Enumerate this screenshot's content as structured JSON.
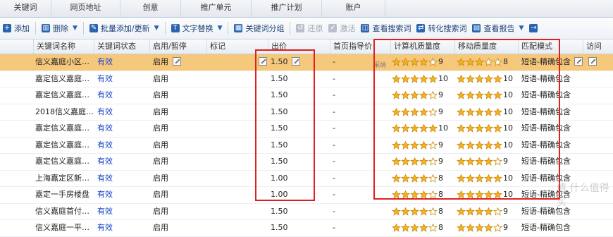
{
  "tabs": [
    {
      "label": "关键词",
      "active": true
    },
    {
      "label": "网页地址",
      "active": false
    },
    {
      "label": "创意",
      "active": false
    },
    {
      "label": "推广单元",
      "active": false
    },
    {
      "label": "推广计划",
      "active": false
    },
    {
      "label": "账户",
      "active": false
    }
  ],
  "toolbar": {
    "add": "添加",
    "delete": "删除",
    "batch": "批量添加/更新",
    "replace": "文字替换",
    "group": "关键词分组",
    "restore": "还原",
    "activate": "激活",
    "view_search": "查看搜索词",
    "convert_search": "转化搜索词",
    "view_report": "查看报告",
    "more_icon": "arrow-right-icon"
  },
  "columns": {
    "name": "关键词名称",
    "status": "关键词状态",
    "enable": "启用/暂停",
    "mark": "标记",
    "bid": "出价",
    "first_page": "首页指导价",
    "pc_quality": "计算机质量度",
    "mobile_quality": "移动质量度",
    "match": "匹配模式",
    "url": "访问URL"
  },
  "selected_row_extra": "采纳",
  "rows": [
    {
      "name": "信义嘉庭小区…",
      "status": "有效",
      "enable": "启用",
      "bid": "1.50",
      "first_page": "-",
      "pc_stars": 4,
      "pc_score": "9",
      "mob_stars": 3,
      "mob_score": "8",
      "match": "短语-精确包含",
      "selected": true
    },
    {
      "name": "嘉定信义嘉庭…",
      "status": "有效",
      "enable": "启用",
      "bid": "1.50",
      "first_page": "-",
      "pc_stars": 5,
      "pc_score": "10",
      "mob_stars": 5,
      "mob_score": "10",
      "match": "短语-精确包含"
    },
    {
      "name": "嘉定信义嘉庭…",
      "status": "有效",
      "enable": "启用",
      "bid": "1.50",
      "first_page": "-",
      "pc_stars": 4,
      "pc_score": "9",
      "mob_stars": 5,
      "mob_score": "10",
      "match": "短语-精确包含"
    },
    {
      "name": "2018信义嘉庭…",
      "status": "有效",
      "enable": "启用",
      "bid": "1.50",
      "first_page": "-",
      "pc_stars": 4,
      "pc_score": "9",
      "mob_stars": 5,
      "mob_score": "10",
      "match": "短语-精确包含"
    },
    {
      "name": "嘉定信义嘉庭…",
      "status": "有效",
      "enable": "启用",
      "bid": "1.50",
      "first_page": "-",
      "pc_stars": 5,
      "pc_score": "10",
      "mob_stars": 5,
      "mob_score": "10",
      "match": "短语-精确包含"
    },
    {
      "name": "嘉定信义嘉庭…",
      "status": "有效",
      "enable": "启用",
      "bid": "1.50",
      "first_page": "-",
      "pc_stars": 4,
      "pc_score": "9",
      "mob_stars": 5,
      "mob_score": "10",
      "match": "短语-精确包含"
    },
    {
      "name": "嘉定信义嘉庭…",
      "status": "有效",
      "enable": "启用",
      "bid": "1.50",
      "first_page": "-",
      "pc_stars": 4,
      "pc_score": "9",
      "mob_stars": 4,
      "mob_score": "9",
      "match": "短语-精确包含"
    },
    {
      "name": "上海嘉定区新…",
      "status": "有效",
      "enable": "启用",
      "bid": "1.00",
      "first_page": "-",
      "pc_stars": 4,
      "pc_score": "8",
      "mob_stars": 5,
      "mob_score": "10",
      "match": "短语-精确包含"
    },
    {
      "name": "嘉定一手房楼盘",
      "status": "有效",
      "enable": "启用",
      "bid": "1.00",
      "first_page": "-",
      "pc_stars": 4,
      "pc_score": "8",
      "mob_stars": 5,
      "mob_score": "10",
      "match": "短语-精确包含"
    },
    {
      "name": "信义嘉庭首付…",
      "status": "有效",
      "enable": "启用",
      "bid": "1.50",
      "first_page": "-",
      "pc_stars": 4,
      "pc_score": "8",
      "mob_stars": 4,
      "mob_score": "9",
      "match": "短语-精确包含"
    },
    {
      "name": "信义嘉庭一平…",
      "status": "有效",
      "enable": "启用",
      "bid": "1.50",
      "first_page": "-",
      "pc_stars": 4,
      "pc_score": "8",
      "mob_stars": 4,
      "mob_score": "9",
      "match": "短语-精确包含"
    }
  ],
  "watermark": "值 什么值得买",
  "colors": {
    "selected_row": "#f6c87c",
    "tab_active": "#2f6fbf",
    "highlight_box": "#e02020",
    "valid_text": "#1b47c8",
    "star": "#f5b324"
  }
}
